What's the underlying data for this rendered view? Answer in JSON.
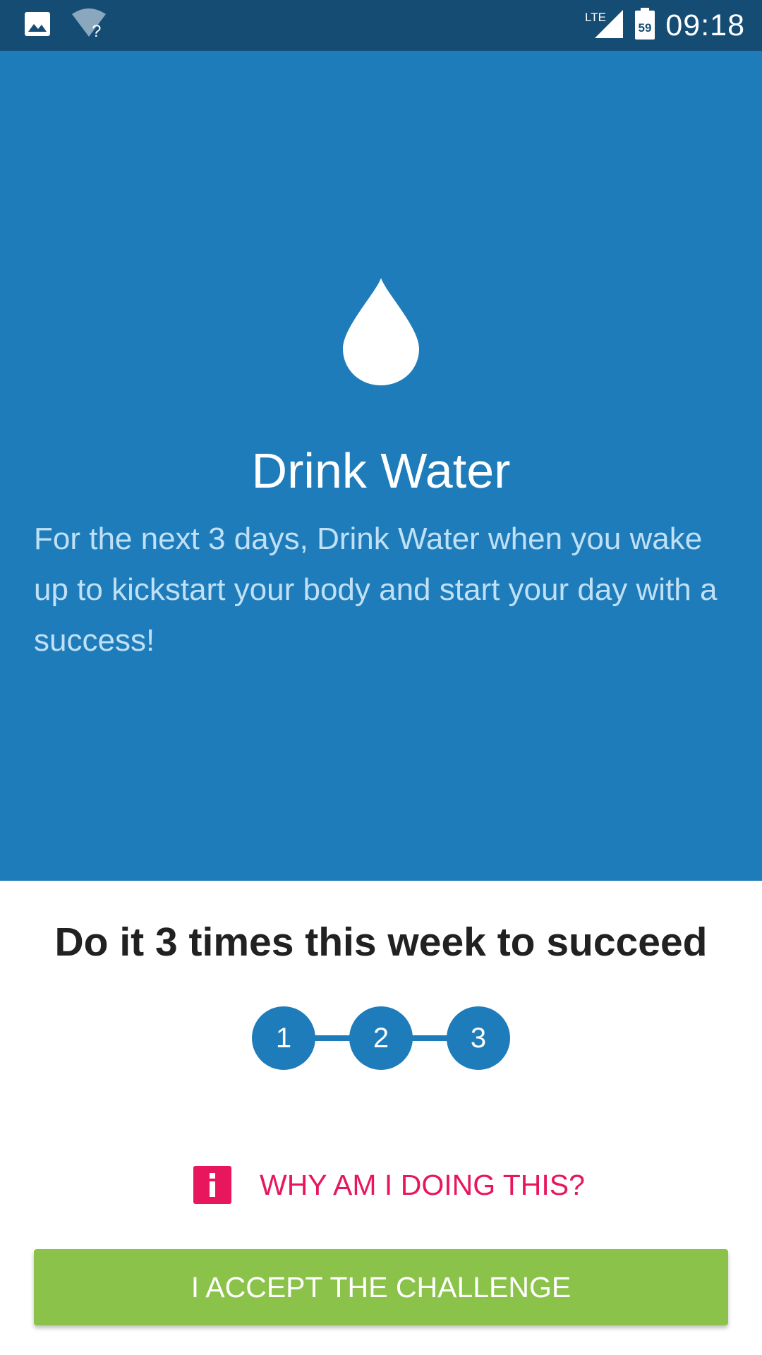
{
  "status_bar": {
    "left_icons": [
      "image-notification-icon",
      "wifi-unknown-icon"
    ],
    "network": "LTE",
    "battery_level": "59",
    "time": "09:18"
  },
  "hero": {
    "icon": "water-drop-icon",
    "title": "Drink Water",
    "description": "For the next 3 days, Drink Water when you wake up to kickstart your body and start your day with a success!",
    "background_color": "#1f7cba"
  },
  "goal": {
    "title": "Do it 3 times this week to succeed",
    "steps": [
      "1",
      "2",
      "3"
    ]
  },
  "why": {
    "icon": "info-icon",
    "label": "WHY AM I DOING THIS?",
    "color": "#e8175d"
  },
  "accept_button": {
    "label": "I ACCEPT THE CHALLENGE",
    "color": "#8bc34a"
  }
}
